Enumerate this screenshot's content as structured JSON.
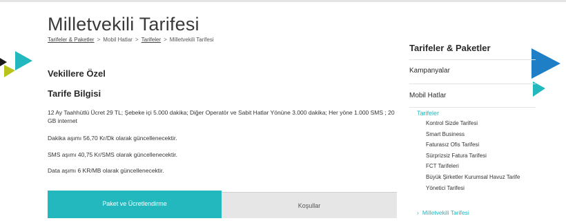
{
  "page": {
    "title": "Milletvekili Tarifesi",
    "breadcrumb": [
      "Tarifeler & Paketler",
      "Mobil Hatlar",
      "Tarifeler",
      "Milletvekili Tarifesi"
    ]
  },
  "main": {
    "heading": "Vekillere Özel",
    "subheading": "Tarife Bilgisi",
    "paragraphs": [
      "12 Ay Taahhütlü Ücret 29 TL; Şebeke içi 5.000 dakika; Diğer Operatör ve Sabit Hatlar Yönüne 3.000 dakika; Her yöne 1.000 SMS ; 20 GB internet",
      "Dakika aşımı 56,70 Kr/Dk olarak güncellenecektir.",
      "SMS aşımı 40,75 Kr/SMS olarak güncellenecektir.",
      "Data aşımı 6 KR/MB olarak güncellenecektir."
    ],
    "tabs": [
      {
        "label": "Paket ve Ücretlendirme",
        "active": true
      },
      {
        "label": "Koşullar",
        "active": false
      }
    ]
  },
  "sidebar": {
    "title": "Tarifeler & Paketler",
    "sections": [
      "Kampanyalar",
      "Mobil Hatlar"
    ],
    "sub": "Tarifeler",
    "items": [
      "Kontrol Sizde Tarifesi",
      "Smart Business",
      "Faturasız Ofis Tarifesi",
      "Sürprizsiz Fatura Tarifesi",
      "FCT Tarifeleri",
      "Büyük Şirketler Kurumsal Havuz Tarife",
      "Yönetici Tarifesi"
    ],
    "current": "Milletvekili Tarifesi"
  },
  "colors": {
    "accent": "#22b8bd",
    "blue": "#1e7fc6",
    "lime": "#b8c31b",
    "tab_inactive": "#e6e6e6"
  }
}
